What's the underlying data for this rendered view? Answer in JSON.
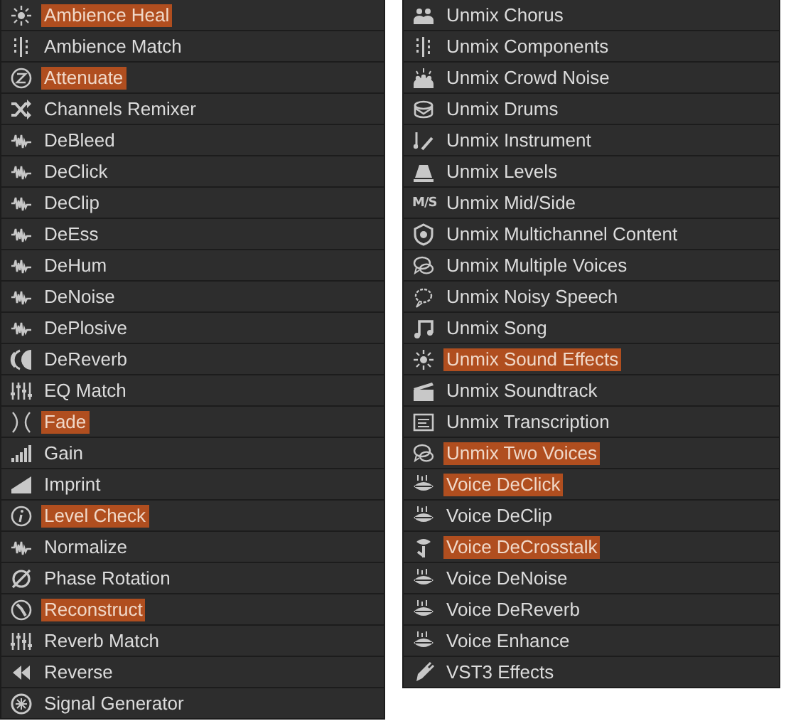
{
  "panels": [
    {
      "items": [
        {
          "label": "Ambience Heal",
          "highlighted": true
        },
        {
          "label": "Ambience Match",
          "highlighted": false
        },
        {
          "label": "Attenuate",
          "highlighted": true
        },
        {
          "label": "Channels Remixer",
          "highlighted": false
        },
        {
          "label": "DeBleed",
          "highlighted": false
        },
        {
          "label": "DeClick",
          "highlighted": false
        },
        {
          "label": "DeClip",
          "highlighted": false
        },
        {
          "label": "DeEss",
          "highlighted": false
        },
        {
          "label": "DeHum",
          "highlighted": false
        },
        {
          "label": "DeNoise",
          "highlighted": false
        },
        {
          "label": "DePlosive",
          "highlighted": false
        },
        {
          "label": "DeReverb",
          "highlighted": false
        },
        {
          "label": "EQ Match",
          "highlighted": false
        },
        {
          "label": "Fade",
          "highlighted": true
        },
        {
          "label": "Gain",
          "highlighted": false
        },
        {
          "label": "Imprint",
          "highlighted": false
        },
        {
          "label": "Level Check",
          "highlighted": true
        },
        {
          "label": "Normalize",
          "highlighted": false
        },
        {
          "label": "Phase Rotation",
          "highlighted": false
        },
        {
          "label": "Reconstruct",
          "highlighted": true
        },
        {
          "label": "Reverb Match",
          "highlighted": false
        },
        {
          "label": "Reverse",
          "highlighted": false
        },
        {
          "label": "Signal Generator",
          "highlighted": false
        }
      ]
    },
    {
      "items": [
        {
          "label": "Unmix Chorus",
          "highlighted": false
        },
        {
          "label": "Unmix Components",
          "highlighted": false
        },
        {
          "label": "Unmix Crowd Noise",
          "highlighted": false
        },
        {
          "label": "Unmix Drums",
          "highlighted": false
        },
        {
          "label": "Unmix Instrument",
          "highlighted": false
        },
        {
          "label": "Unmix Levels",
          "highlighted": false
        },
        {
          "label": "Unmix Mid/Side",
          "highlighted": false,
          "icon_text": "M/S"
        },
        {
          "label": "Unmix Multichannel Content",
          "highlighted": false
        },
        {
          "label": "Unmix Multiple Voices",
          "highlighted": false
        },
        {
          "label": "Unmix Noisy Speech",
          "highlighted": false
        },
        {
          "label": "Unmix Song",
          "highlighted": false
        },
        {
          "label": "Unmix Sound Effects",
          "highlighted": true
        },
        {
          "label": "Unmix Soundtrack",
          "highlighted": false
        },
        {
          "label": "Unmix Transcription",
          "highlighted": false
        },
        {
          "label": "Unmix Two Voices",
          "highlighted": true
        },
        {
          "label": "Voice DeClick",
          "highlighted": true
        },
        {
          "label": "Voice DeClip",
          "highlighted": false
        },
        {
          "label": "Voice DeCrosstalk",
          "highlighted": true
        },
        {
          "label": "Voice DeNoise",
          "highlighted": false
        },
        {
          "label": "Voice DeReverb",
          "highlighted": false
        },
        {
          "label": "Voice Enhance",
          "highlighted": false
        },
        {
          "label": "VST3 Effects",
          "highlighted": false
        }
      ]
    }
  ]
}
